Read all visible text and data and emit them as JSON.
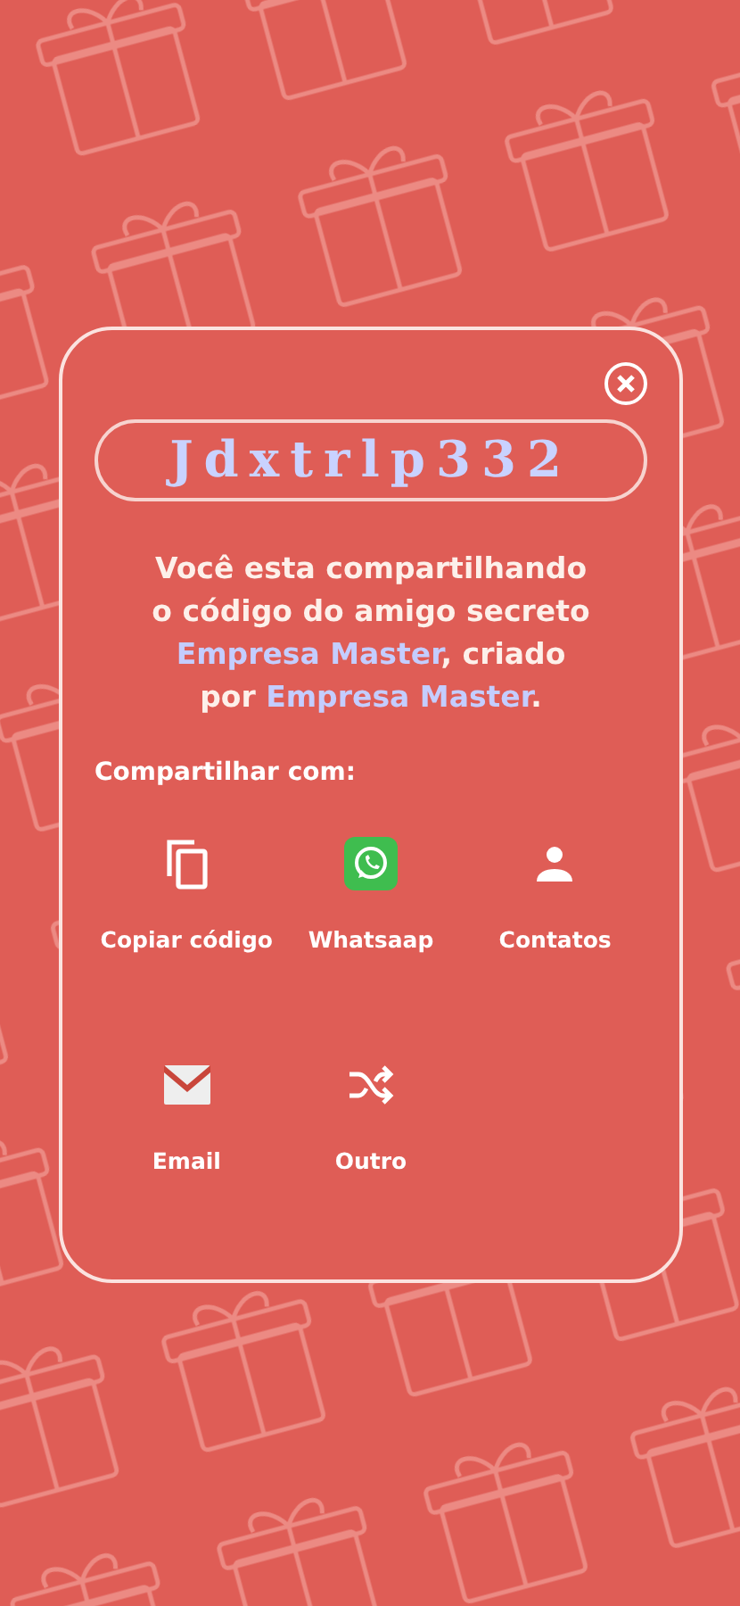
{
  "code": "Jdxtrlp332",
  "message": [
    {
      "kind": "text",
      "text": "Você esta compartilhando o código do amigo secreto "
    },
    {
      "kind": "highlight",
      "text": "Empresa Master"
    },
    {
      "kind": "text",
      "text": ", criado por "
    },
    {
      "kind": "highlight",
      "text": "Empresa Master"
    },
    {
      "kind": "text",
      "text": "."
    }
  ],
  "share_label": "Compartilhar com:",
  "options": [
    {
      "kind": "copy",
      "label": "Copiar código"
    },
    {
      "kind": "whatsapp",
      "label": "Whatsaap"
    },
    {
      "kind": "contacts",
      "label": "Contatos"
    },
    {
      "kind": "email",
      "label": "Email"
    },
    {
      "kind": "other",
      "label": "Outro"
    }
  ]
}
